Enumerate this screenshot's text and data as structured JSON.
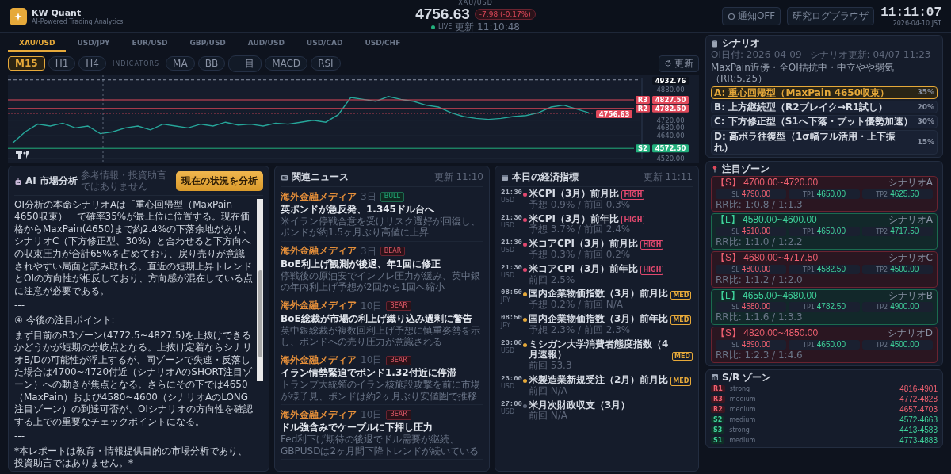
{
  "header": {
    "logo_title": "KW Quant",
    "logo_subtitle": "AI-Powered Trading Analytics",
    "symbol": "XAU/USD",
    "price": "4756.63",
    "change": "-7.98 (-0.17%)",
    "live": "LIVE",
    "updated": "更新 11:10:48",
    "buttons": [
      "通知OFF",
      "研究ログブラウザ"
    ],
    "clock": "11:11:07",
    "date": "2026-04-10 JST"
  },
  "pair_tabs": [
    {
      "label": "XAU/USD",
      "selected": true
    },
    {
      "label": "USD/JPY",
      "selected": false
    },
    {
      "label": "EUR/USD",
      "selected": false
    },
    {
      "label": "GBP/USD",
      "selected": false
    },
    {
      "label": "AUD/USD",
      "selected": false
    },
    {
      "label": "USD/CAD",
      "selected": false
    },
    {
      "label": "USD/CHF",
      "selected": false
    }
  ],
  "toolbar": {
    "timeframes": [
      {
        "label": "M15",
        "selected": true
      },
      {
        "label": "H1",
        "selected": false
      },
      {
        "label": "H4",
        "selected": false
      }
    ],
    "indicators_label": "INDICATORS",
    "indicators": [
      "MA",
      "BB",
      "一目",
      "MACD",
      "RSI"
    ],
    "refresh": "更新"
  },
  "chart": {
    "levels": [
      {
        "kind": "high",
        "price": "4932.76"
      },
      {
        "kind": "resistance",
        "tag": "R3",
        "price": "4827.50"
      },
      {
        "kind": "resistance",
        "tag": "R2",
        "price": "4782.50"
      },
      {
        "kind": "current",
        "price": "4756.63"
      },
      {
        "kind": "support",
        "tag": "S2",
        "price": "4572.50"
      }
    ],
    "chart_data": {
      "type": "line",
      "categories": [
        null,
        null,
        null,
        null,
        null,
        null,
        null,
        null,
        null,
        null,
        null,
        null,
        null,
        null,
        null,
        null,
        null,
        null,
        null,
        null,
        null,
        null,
        null,
        null,
        null,
        null,
        null,
        null,
        null,
        null,
        null,
        null,
        null,
        null,
        null,
        null,
        null,
        null,
        null,
        null,
        null,
        null,
        null,
        null,
        null,
        null,
        null
      ],
      "series": [
        {
          "color": "#26a69a",
          "values": [
            4600,
            4660,
            4700,
            4690,
            4705,
            4680,
            4690,
            4650,
            4660,
            4680,
            4690,
            4670,
            4700,
            4690,
            4680,
            4700,
            4690,
            4710,
            4695,
            4700,
            4690,
            4705,
            4700,
            4710,
            4720,
            4710,
            4750,
            4840,
            4830,
            4820,
            4845,
            4830,
            4820,
            4800,
            4790,
            4760,
            4740,
            4730,
            4725,
            4730,
            4740,
            4745,
            4760,
            4790,
            4800,
            4780,
            4760
          ]
        }
      ],
      "grid": true,
      "ylim": [
        4515,
        4940
      ],
      "yticks": [
        {
          "value": 4880,
          "label": "4880.00"
        },
        {
          "value": 4720,
          "label": "4720.00"
        },
        {
          "value": 4680,
          "label": "4680.00"
        },
        {
          "value": 4640,
          "label": "4640.00"
        },
        {
          "value": 4520,
          "label": "4520.00"
        }
      ]
    }
  },
  "ai_panel": {
    "title": "AI 市場分析",
    "subtitle": "参考情報・投資助言ではありません",
    "button": "現在の状況を分析",
    "paragraphs": [
      "OI分析の本命シナリオAは「重心回帰型（MaxPain 4650収束）」で確率35%が最上位に位置する。現在価格からMaxPain(4650)まで約2.4%の下落余地があり、シナリオC（下方修正型、30%）と合わせると下方向への収束圧力が合計65%を占めており、戻り売りが意識されやすい局面と読み取れる。直近の短期上昇トレンドとOIの方向性が相反しており、方向感が混在している点に注意が必要である。",
      "---",
      "④ 今後の注目ポイント:",
      "まず目前のR3ゾーン(4772.5~4827.5)を上抜けできるかどうかが短期の分岐点となる。上抜け定着ならシナリオB/Dの可能性が浮上するが、同ゾーンで失速・反落した場合は4700~4720付近（シナリオAのSHORT注目ゾーン）への動きが焦点となる。さらにその下では4650（MaxPain）および4580~4600（シナリオAのLONG注目ゾーン）の到達可否が、OIシナリオの方向性を確認する上での重要なチェックポイントになる。",
      "---",
      "*本レポートは教育・情報提供目的の市場分析であり、投資助言ではありません。*"
    ]
  },
  "news": {
    "title": "関連ニュース",
    "updated": "更新 11:10",
    "items": [
      {
        "source": "海外金融メディア",
        "age": "3日",
        "kind": "bull",
        "tag": "BULL",
        "title": "英ポンドが急反発、1.345ドル台へ",
        "summary": "米イラン停戦合意を受けリスク選好が回復し、ポンドが約1.5ヶ月ぶり高値に上昇"
      },
      {
        "source": "海外金融メディア",
        "age": "3日",
        "kind": "bear",
        "tag": "BEAR",
        "title": "BoE利上げ観測が後退、年1回に修正",
        "summary": "停戦後の原油安でインフレ圧力が緩み、英中銀の年内利上げ予想が2回から1回へ縮小"
      },
      {
        "source": "海外金融メディア",
        "age": "10日",
        "kind": "bear",
        "tag": "BEAR",
        "title": "BoE総裁が市場の利上げ織り込み過剰に警告",
        "summary": "英中銀総裁が複数回利上げ予想に慎重姿勢を示し、ポンドへの売り圧力が意識される"
      },
      {
        "source": "海外金融メディア",
        "age": "10日",
        "kind": "bear",
        "tag": "BEAR",
        "title": "イラン情勢緊迫でポンド1.32付近に停滞",
        "summary": "トランプ大統領のイラン核施設攻撃を前に市場が様子見、ポンドは約2ヶ月ぶり安値圏で推移"
      },
      {
        "source": "海外金融メディア",
        "age": "10日",
        "kind": "bear",
        "tag": "BEAR",
        "title": "ドル強含みでケーブルに下押し圧力",
        "summary": "Fed利下げ期待の後退でドル需要が継続、GBPUSDは2ヶ月間下降トレンドが続いている"
      }
    ]
  },
  "calendar": {
    "title": "本日の経済指標",
    "updated": "更新 11:11",
    "items": [
      {
        "time": "21:30",
        "currency": "USD",
        "kind": "high",
        "name": "米CPI（3月）前月比",
        "tag": "HIGH",
        "detail": "予想 0.9% / 前回 0.3%"
      },
      {
        "time": "21:30",
        "currency": "USD",
        "kind": "high",
        "name": "米CPI（3月）前年比",
        "tag": "HIGH",
        "detail": "予想 3.7% / 前回 2.4%"
      },
      {
        "time": "21:30",
        "currency": "USD",
        "kind": "high",
        "name": "米コアCPI（3月）前月比",
        "tag": "HIGH",
        "detail": "予想 0.3% / 前回 0.2%"
      },
      {
        "time": "21:30",
        "currency": "USD",
        "kind": "high",
        "name": "米コアCPI（3月）前年比",
        "tag": "HIGH",
        "detail": "前回 2.5%"
      },
      {
        "time": "08:50",
        "currency": "JPY",
        "kind": "medium",
        "name": "国内企業物価指数（3月）前月比",
        "tag": "MED",
        "detail": "予想 0.2% / 前回 N/A"
      },
      {
        "time": "08:50",
        "currency": "JPY",
        "kind": "medium",
        "name": "国内企業物価指数（3月）前年比",
        "tag": "MED",
        "detail": "予想 2.3% / 前回 2.3%"
      },
      {
        "time": "23:00",
        "currency": "USD",
        "kind": "medium",
        "name": "ミシガン大学消費者態度指数（4月速報）",
        "tag": "MED",
        "detail": "前回 53.3"
      },
      {
        "time": "23:00",
        "currency": "USD",
        "kind": "medium",
        "name": "米製造業新規受注（2月）前月比",
        "tag": "MED",
        "detail": "前回 N/A"
      },
      {
        "time": "27:00",
        "currency": "USD",
        "kind": "low",
        "name": "米月次財政収支（3月）",
        "detail": "前回 N/A"
      }
    ]
  },
  "scenario": {
    "title": "シナリオ",
    "meta": [
      "OI日付: 2026-04-09",
      "シナリオ更新: 04/07 11:23"
    ],
    "summary": "MaxPain近傍・全OI拮抗中・中立やや弱気（RR:5.25）",
    "items": [
      {
        "label": "A: 重心回帰型（MaxPain 4650収束）",
        "pct": "35%",
        "selected": true
      },
      {
        "label": "B: 上方継続型（R2ブレイク→R1試し）",
        "pct": "20%",
        "selected": false
      },
      {
        "label": "C: 下方修正型（S1へ下落・プット優勢加速）",
        "pct": "30%",
        "selected": false
      },
      {
        "label": "D: 高ボラ往復型（1σ幅フル活用・上下振れ）",
        "pct": "15%",
        "selected": false
      }
    ]
  },
  "zones": {
    "title": "注目ゾーン",
    "items": [
      {
        "kind": "short",
        "range": "【S】 4700.00~4720.00",
        "scenario": "シナリオA",
        "levels": [
          {
            "label": "SL",
            "value": "4790.00"
          },
          {
            "label": "TP1",
            "value": "4650.00"
          },
          {
            "label": "TP2",
            "value": "4625.50"
          }
        ],
        "rr": "RR比: 1:0.8 / 1:1.3"
      },
      {
        "kind": "long",
        "range": "【L】 4580.00~4600.00",
        "scenario": "シナリオA",
        "levels": [
          {
            "label": "SL",
            "value": "4510.00"
          },
          {
            "label": "TP1",
            "value": "4650.00"
          },
          {
            "label": "TP2",
            "value": "4717.50"
          }
        ],
        "rr": "RR比: 1:1.0 / 1:2.2"
      },
      {
        "kind": "short",
        "range": "【S】 4680.00~4717.50",
        "scenario": "シナリオC",
        "levels": [
          {
            "label": "SL",
            "value": "4800.00"
          },
          {
            "label": "TP1",
            "value": "4582.50"
          },
          {
            "label": "TP2",
            "value": "4500.00"
          }
        ],
        "rr": "RR比: 1:1.2 / 1:2.0"
      },
      {
        "kind": "long",
        "range": "【L】 4655.00~4680.00",
        "scenario": "シナリオB",
        "levels": [
          {
            "label": "SL",
            "value": "4580.00"
          },
          {
            "label": "TP1",
            "value": "4782.50"
          },
          {
            "label": "TP2",
            "value": "4900.00"
          }
        ],
        "rr": "RR比: 1:1.6 / 1:3.3"
      },
      {
        "kind": "short",
        "range": "【S】 4820.00~4850.00",
        "scenario": "シナリオD",
        "levels": [
          {
            "label": "SL",
            "value": "4890.00"
          },
          {
            "label": "TP1",
            "value": "4650.00"
          },
          {
            "label": "TP2",
            "value": "4500.00"
          }
        ],
        "rr": "RR比: 1:2.3 / 1:4.6"
      }
    ]
  },
  "sr_zones": {
    "title": "S/R ゾーン",
    "items": [
      {
        "kind": "resistance",
        "tag": "R1",
        "strength": "strong",
        "range": "4816-4901"
      },
      {
        "kind": "resistance",
        "tag": "R3",
        "strength": "medium",
        "range": "4772-4828"
      },
      {
        "kind": "resistance",
        "tag": "R2",
        "strength": "medium",
        "range": "4657-4703"
      },
      {
        "kind": "support",
        "tag": "S2",
        "strength": "medium",
        "range": "4572-4663"
      },
      {
        "kind": "support",
        "tag": "S3",
        "strength": "strong",
        "range": "4413-4583"
      },
      {
        "kind": "support",
        "tag": "S1",
        "strength": "medium",
        "range": "4773-4883"
      }
    ]
  }
}
